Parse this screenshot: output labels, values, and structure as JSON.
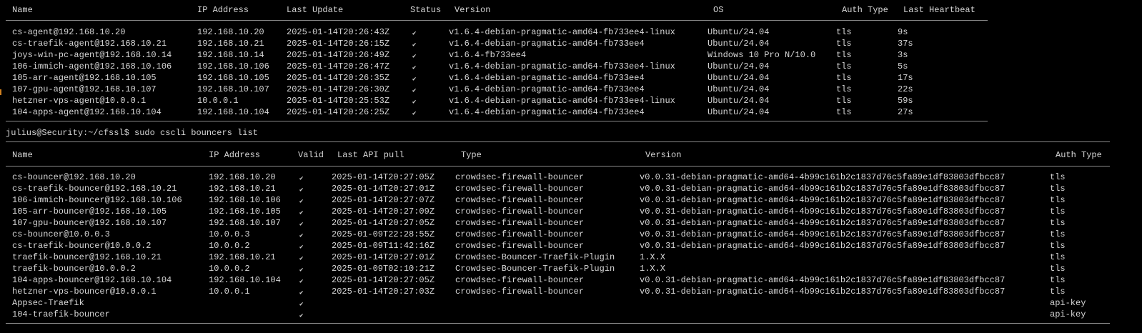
{
  "colors": {
    "background": "#000000",
    "text": "#d6d6d6",
    "rule": "#8a8a8a",
    "cursor_accent": "#d08020"
  },
  "check_icon": "✔",
  "machines": {
    "headers": [
      "Name",
      "IP Address",
      "Last Update",
      "Status",
      "Version",
      "OS",
      "Auth Type",
      "Last Heartbeat"
    ],
    "rows": [
      [
        "cs-agent@192.168.10.20",
        "192.168.10.20",
        "2025-01-14T20:26:43Z",
        "✔",
        "v1.6.4-debian-pragmatic-amd64-fb733ee4-linux",
        "Ubuntu/24.04",
        "tls",
        "9s"
      ],
      [
        "cs-traefik-agent@192.168.10.21",
        "192.168.10.21",
        "2025-01-14T20:26:15Z",
        "✔",
        "v1.6.4-debian-pragmatic-amd64-fb733ee4",
        "Ubuntu/24.04",
        "tls",
        "37s"
      ],
      [
        "joys-win-pc-agent@192.168.10.14",
        "192.168.10.14",
        "2025-01-14T20:26:49Z",
        "✔",
        "v1.6.4-fb733ee4",
        "Windows 10 Pro N/10.0",
        "tls",
        "3s"
      ],
      [
        "106-immich-agent@192.168.10.106",
        "192.168.10.106",
        "2025-01-14T20:26:47Z",
        "✔",
        "v1.6.4-debian-pragmatic-amd64-fb733ee4-linux",
        "Ubuntu/24.04",
        "tls",
        "5s"
      ],
      [
        "105-arr-agent@192.168.10.105",
        "192.168.10.105",
        "2025-01-14T20:26:35Z",
        "✔",
        "v1.6.4-debian-pragmatic-amd64-fb733ee4",
        "Ubuntu/24.04",
        "tls",
        "17s"
      ],
      [
        "107-gpu-agent@192.168.10.107",
        "192.168.10.107",
        "2025-01-14T20:26:30Z",
        "✔",
        "v1.6.4-debian-pragmatic-amd64-fb733ee4",
        "Ubuntu/24.04",
        "tls",
        "22s"
      ],
      [
        "hetzner-vps-agent@10.0.0.1",
        "10.0.0.1",
        "2025-01-14T20:25:53Z",
        "✔",
        "v1.6.4-debian-pragmatic-amd64-fb733ee4-linux",
        "Ubuntu/24.04",
        "tls",
        "59s"
      ],
      [
        "104-apps-agent@192.168.10.104",
        "192.168.10.104",
        "2025-01-14T20:26:25Z",
        "✔",
        "v1.6.4-debian-pragmatic-amd64-fb733ee4",
        "Ubuntu/24.04",
        "tls",
        "27s"
      ]
    ]
  },
  "prompt": {
    "text": "julius@Security:~/cfssl$ sudo cscli bouncers list"
  },
  "bouncers": {
    "headers": [
      "Name",
      "IP Address",
      "Valid",
      "Last API pull",
      "Type",
      "Version",
      "Auth Type"
    ],
    "rows": [
      [
        "cs-bouncer@192.168.10.20",
        "192.168.10.20",
        "✔",
        "2025-01-14T20:27:05Z",
        "crowdsec-firewall-bouncer",
        "v0.0.31-debian-pragmatic-amd64-4b99c161b2c1837d76c5fa89e1df83803dfbcc87",
        "tls"
      ],
      [
        "cs-traefik-bouncer@192.168.10.21",
        "192.168.10.21",
        "✔",
        "2025-01-14T20:27:01Z",
        "crowdsec-firewall-bouncer",
        "v0.0.31-debian-pragmatic-amd64-4b99c161b2c1837d76c5fa89e1df83803dfbcc87",
        "tls"
      ],
      [
        "106-immich-bouncer@192.168.10.106",
        "192.168.10.106",
        "✔",
        "2025-01-14T20:27:07Z",
        "crowdsec-firewall-bouncer",
        "v0.0.31-debian-pragmatic-amd64-4b99c161b2c1837d76c5fa89e1df83803dfbcc87",
        "tls"
      ],
      [
        "105-arr-bouncer@192.168.10.105",
        "192.168.10.105",
        "✔",
        "2025-01-14T20:27:09Z",
        "crowdsec-firewall-bouncer",
        "v0.0.31-debian-pragmatic-amd64-4b99c161b2c1837d76c5fa89e1df83803dfbcc87",
        "tls"
      ],
      [
        "107-gpu-bouncer@192.168.10.107",
        "192.168.10.107",
        "✔",
        "2025-01-14T20:27:05Z",
        "crowdsec-firewall-bouncer",
        "v0.0.31-debian-pragmatic-amd64-4b99c161b2c1837d76c5fa89e1df83803dfbcc87",
        "tls"
      ],
      [
        "cs-bouncer@10.0.0.3",
        "10.0.0.3",
        "✔",
        "2025-01-09T22:28:55Z",
        "crowdsec-firewall-bouncer",
        "v0.0.31-debian-pragmatic-amd64-4b99c161b2c1837d76c5fa89e1df83803dfbcc87",
        "tls"
      ],
      [
        "cs-traefik-bouncer@10.0.0.2",
        "10.0.0.2",
        "✔",
        "2025-01-09T11:42:16Z",
        "crowdsec-firewall-bouncer",
        "v0.0.31-debian-pragmatic-amd64-4b99c161b2c1837d76c5fa89e1df83803dfbcc87",
        "tls"
      ],
      [
        "traefik-bouncer@192.168.10.21",
        "192.168.10.21",
        "✔",
        "2025-01-14T20:27:01Z",
        "Crowdsec-Bouncer-Traefik-Plugin",
        "1.X.X",
        "tls"
      ],
      [
        "traefik-bouncer@10.0.0.2",
        "10.0.0.2",
        "✔",
        "2025-01-09T02:10:21Z",
        "Crowdsec-Bouncer-Traefik-Plugin",
        "1.X.X",
        "tls"
      ],
      [
        "104-apps-bouncer@192.168.10.104",
        "192.168.10.104",
        "✔",
        "2025-01-14T20:27:05Z",
        "crowdsec-firewall-bouncer",
        "v0.0.31-debian-pragmatic-amd64-4b99c161b2c1837d76c5fa89e1df83803dfbcc87",
        "tls"
      ],
      [
        "hetzner-vps-bouncer@10.0.0.1",
        "10.0.0.1",
        "✔",
        "2025-01-14T20:27:03Z",
        "crowdsec-firewall-bouncer",
        "v0.0.31-debian-pragmatic-amd64-4b99c161b2c1837d76c5fa89e1df83803dfbcc87",
        "tls"
      ],
      [
        "Appsec-Traefik",
        "",
        "✔",
        "",
        "",
        "",
        "api-key"
      ],
      [
        "104-traefik-bouncer",
        "",
        "✔",
        "",
        "",
        "",
        "api-key"
      ]
    ]
  }
}
